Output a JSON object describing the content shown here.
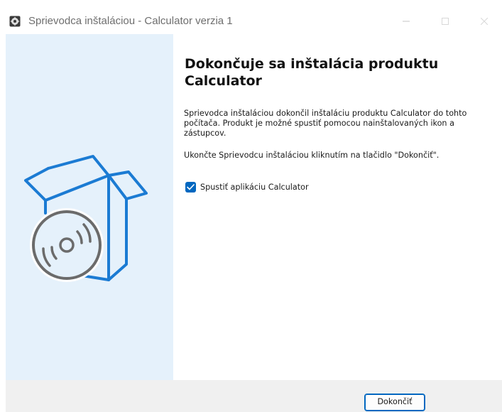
{
  "window": {
    "title": "Sprievodca inštaláciou - Calculator verzia 1"
  },
  "main": {
    "heading": "Dokončuje sa inštalácia produktu Calculator",
    "paragraph1": "Sprievodca inštaláciou dokončil inštaláciu produktu Calculator do tohto počítača. Produkt je možné spustiť pomocou nainštalovaných ikon a zástupcov.",
    "paragraph2": "Ukončte Sprievodcu inštaláciou kliknutím na tlačidlo \"Dokončiť\".",
    "launch_checkbox": {
      "label": "Spustiť aplikáciu Calculator",
      "checked": true
    }
  },
  "footer": {
    "finish_label": "Dokončiť"
  },
  "icons": {
    "app": "installer-app-icon",
    "illustration": "box-with-disc-illustration",
    "minimize": "minimize-icon",
    "maximize": "maximize-icon",
    "close": "close-icon",
    "check": "checkmark-icon"
  },
  "colors": {
    "sidebar_background": "#e5f1fb",
    "accent": "#0067c0",
    "illustration_blue": "#1b7bd3",
    "footer_background": "#f0f0f0"
  }
}
